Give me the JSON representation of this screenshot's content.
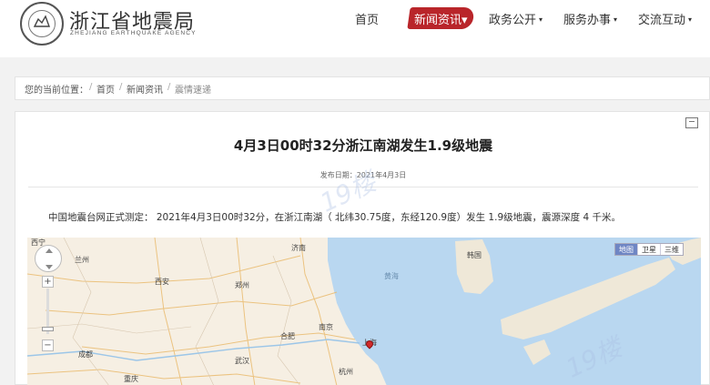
{
  "header": {
    "site_title": "浙江省地震局",
    "site_subtitle": "ZHEJIANG EARTHQUAKE AGENCY",
    "logo_icon": "seal-emblem-icon",
    "nav": [
      {
        "label": "首页",
        "dropdown": false,
        "active": false
      },
      {
        "label": "新闻资讯",
        "dropdown": true,
        "active": true
      },
      {
        "label": "政务公开",
        "dropdown": true,
        "active": false
      },
      {
        "label": "服务办事",
        "dropdown": true,
        "active": false
      },
      {
        "label": "交流互动",
        "dropdown": true,
        "active": false
      }
    ],
    "active_color": "#b9252a"
  },
  "breadcrumb": {
    "prefix": "您的当前位置：",
    "items": [
      "首页",
      "新闻资讯",
      "震情速递"
    ],
    "separator": "/"
  },
  "article": {
    "title": "4月3日00时32分浙江南湖发生1.9级地震",
    "date_label": "发布日期：2021年4月3日",
    "body": "中国地震台网正式测定： 2021年4月3日00时32分，在浙江南湖（ 北纬30.75度，东经120.9度）发生 1.9级地震，震源深度 4 千米。",
    "print_icon": "print-icon"
  },
  "map": {
    "type_options": [
      "地图",
      "卫星",
      "三维"
    ],
    "selected_type": "地图",
    "labels": [
      "西宁",
      "兰州",
      "济南",
      "韩国",
      "西安",
      "郑州",
      "黄海",
      "南京",
      "合肥",
      "上海",
      "武汉",
      "成都",
      "杭州",
      "重庆"
    ],
    "controls": {
      "zoom_in": "+",
      "zoom_out": "−"
    }
  }
}
